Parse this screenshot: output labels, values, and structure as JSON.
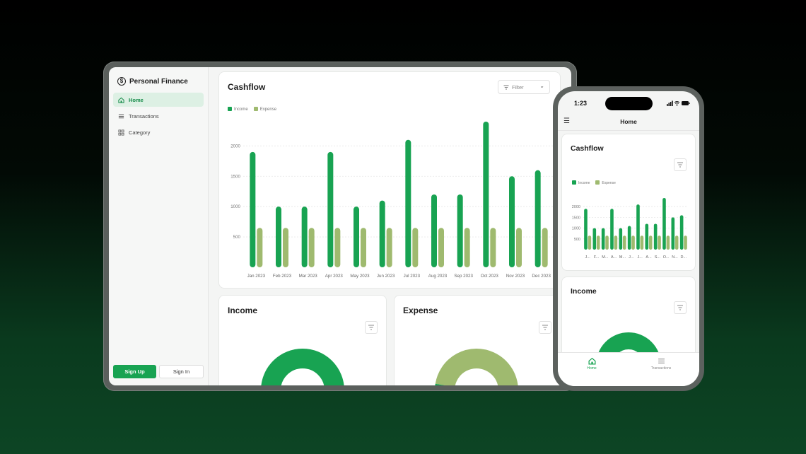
{
  "desktop": {
    "app_name": "Personal Finance",
    "nav": [
      {
        "label": "Home",
        "icon": "home-icon",
        "active": true
      },
      {
        "label": "Transactions",
        "icon": "list-icon",
        "active": false
      },
      {
        "label": "Category",
        "icon": "grid-icon",
        "active": false
      }
    ],
    "auth": {
      "signup": "Sign Up",
      "signin": "Sign In"
    },
    "cashflow": {
      "title": "Cashflow",
      "filter_label": "Filter"
    },
    "income_card": {
      "title": "Income"
    },
    "expense_card": {
      "title": "Expense"
    }
  },
  "phone": {
    "time": "1:23",
    "header_title": "Home",
    "cashflow_title": "Cashflow",
    "income_title": "Income",
    "tabs": [
      {
        "label": "Home",
        "icon": "home-icon",
        "active": true
      },
      {
        "label": "Transactions",
        "icon": "list-icon",
        "active": false
      }
    ]
  },
  "colors": {
    "income": "#18a352",
    "expense": "#9fba6f",
    "accent": "#18a352"
  },
  "chart_data": [
    {
      "type": "bar",
      "title": "Cashflow",
      "categories": [
        "Jan 2023",
        "Feb 2023",
        "Mar 2023",
        "Apr 2023",
        "May 2023",
        "Jun 2023",
        "Jul 2023",
        "Aug 2023",
        "Sep 2023",
        "Oct 2023",
        "Nov 2023",
        "Dec 2023"
      ],
      "series": [
        {
          "name": "Income",
          "values": [
            1900,
            1000,
            1000,
            1900,
            1000,
            1100,
            2100,
            1200,
            1200,
            2400,
            1500,
            1600
          ]
        },
        {
          "name": "Expense",
          "values": [
            650,
            650,
            650,
            650,
            650,
            650,
            650,
            650,
            650,
            650,
            650,
            650
          ]
        }
      ],
      "y_ticks": [
        500,
        1000,
        1500,
        2000
      ],
      "ylim": [
        0,
        2400
      ],
      "grid": true,
      "legend": "top-left"
    },
    {
      "type": "bar",
      "title": "Cashflow",
      "categories": [
        "J...",
        "F...",
        "M...",
        "A...",
        "M...",
        "J...",
        "J...",
        "A...",
        "S...",
        "O...",
        "N...",
        "D..."
      ],
      "series": [
        {
          "name": "Income",
          "values": [
            1900,
            1000,
            1000,
            1900,
            1000,
            1100,
            2100,
            1200,
            1200,
            2400,
            1500,
            1600
          ]
        },
        {
          "name": "Expense",
          "values": [
            650,
            650,
            650,
            650,
            650,
            650,
            650,
            650,
            650,
            650,
            650,
            650
          ]
        }
      ],
      "y_ticks": [
        500,
        1000,
        1500,
        2000
      ],
      "ylim": [
        0,
        2400
      ],
      "grid": true,
      "legend": "top-left"
    },
    {
      "type": "pie",
      "title": "Income",
      "values": [
        100
      ],
      "style": "donut"
    },
    {
      "type": "pie",
      "title": "Expense",
      "values": [
        88,
        12
      ],
      "style": "donut"
    }
  ]
}
